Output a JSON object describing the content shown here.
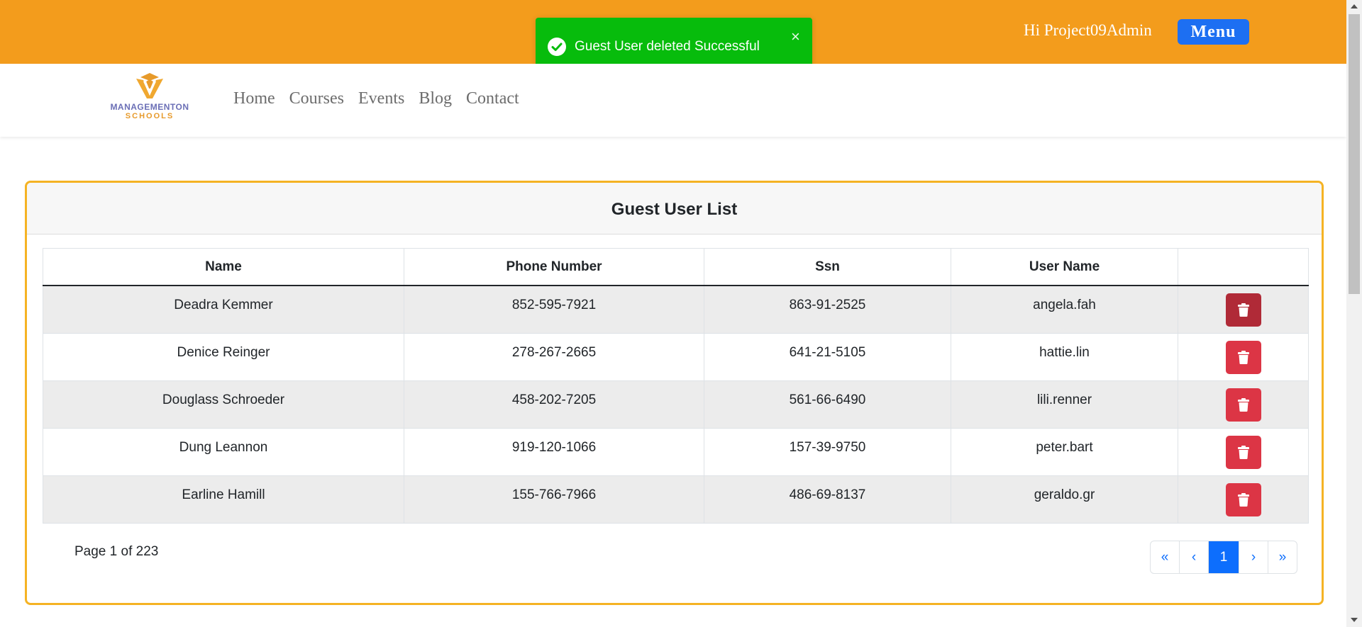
{
  "topbar": {
    "greeting": "Hi Project09Admin",
    "menu_label": "Menu",
    "background": "#f39c1c"
  },
  "toast": {
    "message": "Guest User deleted Successful",
    "close": "×",
    "icon": "check-circle-icon",
    "color": "#07bc0c"
  },
  "logo": {
    "name": "MANAGEMENTON",
    "sub": "SCHOOLS"
  },
  "nav": {
    "items": [
      "Home",
      "Courses",
      "Events",
      "Blog",
      "Contact"
    ]
  },
  "card": {
    "title": "Guest User List",
    "columns": [
      "Name",
      "Phone Number",
      "Ssn",
      "User Name",
      ""
    ],
    "rows": [
      {
        "name": "Deadra Kemmer",
        "phone": "852-595-7921",
        "ssn": "863-91-2525",
        "username": "angela.fah"
      },
      {
        "name": "Denice Reinger",
        "phone": "278-267-2665",
        "ssn": "641-21-5105",
        "username": "hattie.lin"
      },
      {
        "name": "Douglass Schroeder",
        "phone": "458-202-7205",
        "ssn": "561-66-6490",
        "username": "lili.renner"
      },
      {
        "name": "Dung Leannon",
        "phone": "919-120-1066",
        "ssn": "157-39-9750",
        "username": "peter.bart"
      },
      {
        "name": "Earline Hamill",
        "phone": "155-766-7966",
        "ssn": "486-69-8137",
        "username": "geraldo.gr"
      }
    ],
    "delete_icon": "trash-icon",
    "page_info": "Page 1 of 223"
  },
  "pagination": {
    "first": "«",
    "prev": "‹",
    "current": "1",
    "next": "›",
    "last": "»"
  }
}
